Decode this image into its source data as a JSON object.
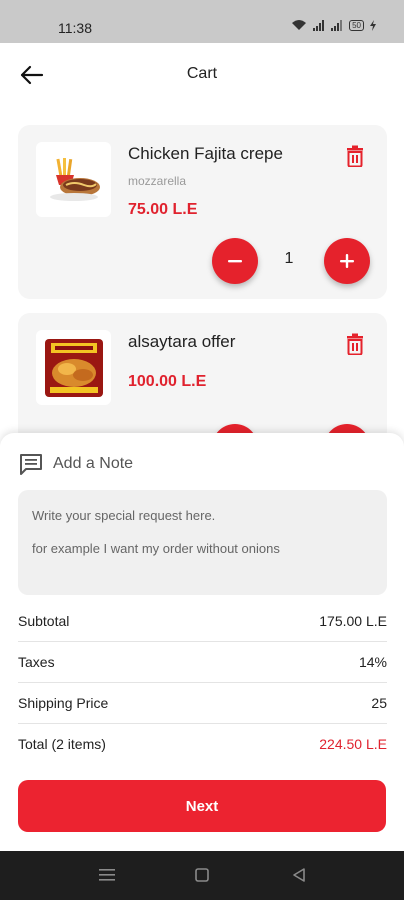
{
  "status_bar": {
    "time": "11:38",
    "battery": "50"
  },
  "header": {
    "title": "Cart"
  },
  "cart": {
    "items": [
      {
        "name": "Chicken Fajita crepe",
        "subtitle": "mozzarella",
        "price": "75.00 L.E",
        "quantity": "1"
      },
      {
        "name": "alsaytara offer",
        "price": "100.00 L.E"
      }
    ]
  },
  "note": {
    "title": "Add a Note",
    "placeholder_line1": "Write your special request here.",
    "placeholder_line2": "for example I want my order without onions"
  },
  "summary": {
    "subtotal_label": "Subtotal",
    "subtotal_value": "175.00 L.E",
    "taxes_label": "Taxes",
    "taxes_value": "14%",
    "shipping_label": "Shipping Price",
    "shipping_value": "25",
    "total_label": "Total (2 items)",
    "total_value": "224.50 L.E"
  },
  "actions": {
    "next_label": "Next"
  },
  "colors": {
    "accent": "#e5222c",
    "price": "#e0222e"
  },
  "icons": [
    "back-arrow-icon",
    "trash-icon",
    "minus-icon",
    "plus-icon",
    "note-icon",
    "wifi-icon",
    "signal-icon",
    "battery-icon"
  ]
}
